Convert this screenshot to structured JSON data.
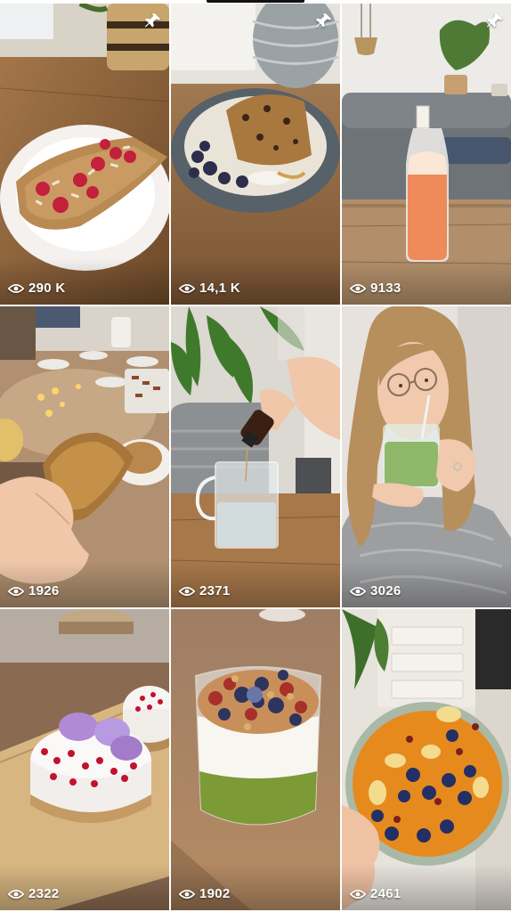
{
  "feed": {
    "tiles": [
      {
        "views": "290 K",
        "pinned": true,
        "scene": "crepe-raspberries",
        "icon": "eye-icon"
      },
      {
        "views": "14,1 K",
        "pinned": true,
        "scene": "baked-oats-blueberries",
        "icon": "eye-icon"
      },
      {
        "views": "9133",
        "pinned": true,
        "scene": "juice-bottle",
        "icon": "eye-icon"
      },
      {
        "views": "1926",
        "pinned": false,
        "scene": "toast-in-hand",
        "icon": "eye-icon"
      },
      {
        "views": "2371",
        "pinned": false,
        "scene": "dropper-water-glass",
        "icon": "eye-icon"
      },
      {
        "views": "3026",
        "pinned": false,
        "scene": "woman-matcha",
        "icon": "eye-icon"
      },
      {
        "views": "2322",
        "pinned": false,
        "scene": "cheesecake-flowers",
        "icon": "eye-icon"
      },
      {
        "views": "1902",
        "pinned": false,
        "scene": "yogurt-parfait",
        "icon": "eye-icon"
      },
      {
        "views": "2461",
        "pinned": false,
        "scene": "pumpkin-oats-bowl",
        "icon": "eye-icon"
      }
    ]
  },
  "colors": {
    "background": "#ffffff",
    "overlay_text": "#ffffff"
  }
}
